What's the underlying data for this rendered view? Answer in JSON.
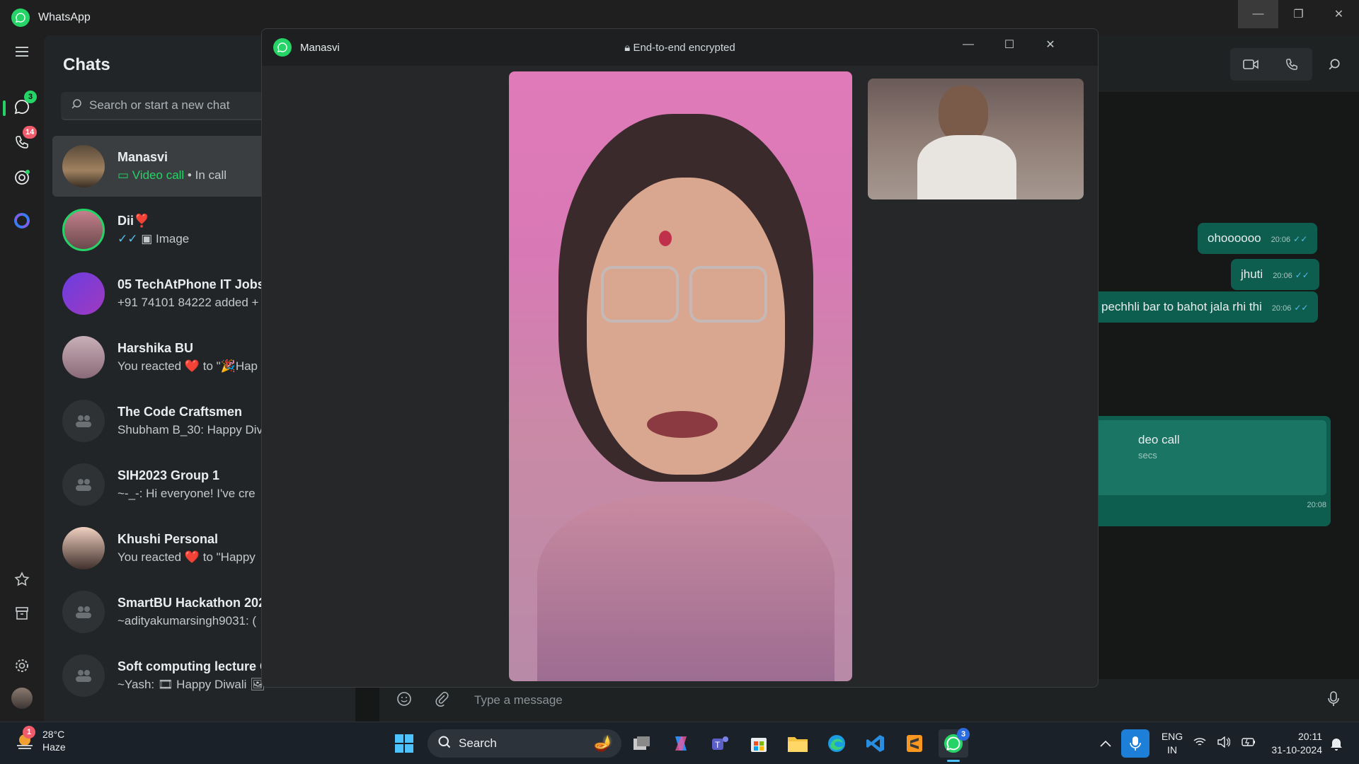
{
  "app": {
    "title": "WhatsApp"
  },
  "rail": {
    "chats_badge": "3",
    "calls_badge": "14"
  },
  "chats": {
    "heading": "Chats",
    "search_placeholder": "Search or start a new chat",
    "items": [
      {
        "name": "Manasvi",
        "last_green": "Video call",
        "last": " • In call"
      },
      {
        "name": "Dii❣️",
        "last": "Image"
      },
      {
        "name": "05 TechAtPhone IT Jobs U",
        "last": "+91 74101 84222 added +"
      },
      {
        "name": "Harshika BU",
        "last": "You reacted ❤️ to \"🎉Hap"
      },
      {
        "name": "The Code Craftsmen",
        "last": "Shubham B_30: Happy Div"
      },
      {
        "name": "SIH2023 Group 1",
        "last": "~-_-: Hi everyone!  I've cre"
      },
      {
        "name": "Khushi Personal",
        "last": "You reacted ❤️ to \"Happy"
      },
      {
        "name": "SmartBU Hackathon 2024",
        "last": "~adityakumarsingh9031: ("
      },
      {
        "name": "Soft computing lecture G",
        "last": "~Yash: 🎞 Happy Diwali 🖼"
      }
    ]
  },
  "conversation": {
    "messages": [
      {
        "text": "ohoooooo",
        "time": "20:06"
      },
      {
        "text": "jhuti",
        "time": "20:06"
      },
      {
        "text": "pechhli bar to bahot jala rhi thi",
        "time": "20:06"
      }
    ],
    "call_card": {
      "title": "deo call",
      "sub": "secs",
      "time": "20:08"
    },
    "input_placeholder": "Type a message"
  },
  "video_call": {
    "contact": "Manasvi",
    "encryption": "End-to-end encrypted"
  },
  "taskbar": {
    "weather_temp": "28°C",
    "weather_desc": "Haze",
    "weather_badge": "1",
    "search_label": "Search",
    "whatsapp_badge": "3",
    "lang1": "ENG",
    "lang2": "IN",
    "time": "20:11",
    "date": "31-10-2024"
  },
  "colors": {
    "accent": "#25d366",
    "bubble_out": "#0e5e4f",
    "badge_red": "#f15c6d"
  }
}
